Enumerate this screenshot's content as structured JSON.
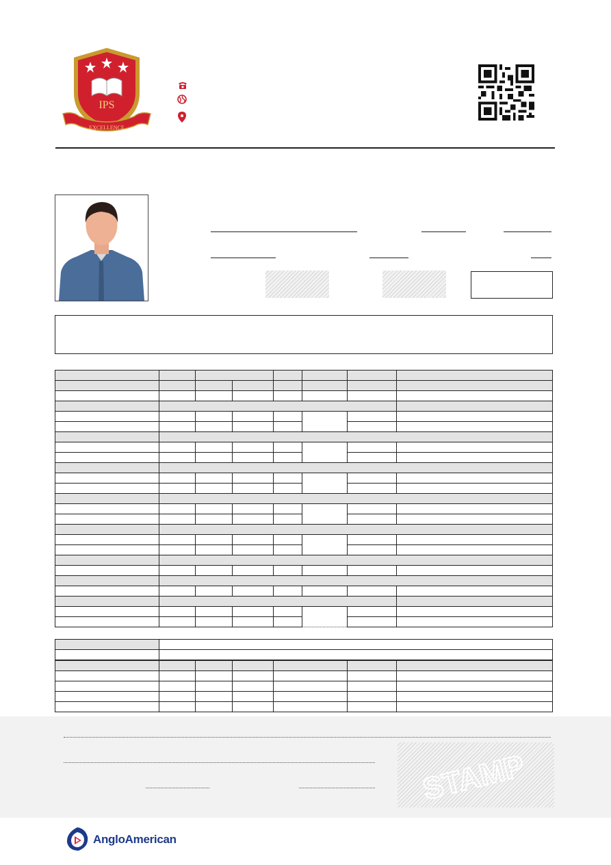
{
  "header": {
    "logo_initials": "IPS",
    "logo_motto": "EXCELLENCE",
    "contact_icons": [
      "phone-icon",
      "globe-icon",
      "location-pin-icon"
    ],
    "accent_color": "#d0202e"
  },
  "stamp": {
    "text": "STAMP"
  },
  "brand": {
    "name": "AngloAmerican",
    "color": "#1d3a8a"
  },
  "colors": {
    "section_fill": "#e3e3e3",
    "footer_band": "#f2f2f2"
  }
}
